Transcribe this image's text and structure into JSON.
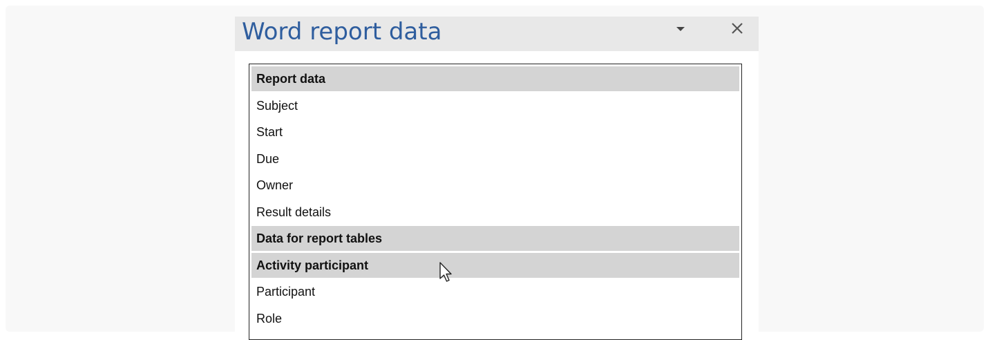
{
  "pane": {
    "title": "Word report data",
    "close_icon": "close-icon",
    "dropdown_icon": "dropdown-arrow-icon"
  },
  "list": {
    "rows": [
      {
        "label": "Report data",
        "type": "header"
      },
      {
        "label": "Subject",
        "type": "item"
      },
      {
        "label": "Start",
        "type": "item"
      },
      {
        "label": "Due",
        "type": "item"
      },
      {
        "label": "Owner",
        "type": "item"
      },
      {
        "label": "Result details",
        "type": "item"
      },
      {
        "label": "Data for report tables",
        "type": "header"
      },
      {
        "label": "Activity participant",
        "type": "header"
      },
      {
        "label": "Participant",
        "type": "item"
      },
      {
        "label": "Role",
        "type": "item"
      }
    ]
  },
  "colors": {
    "title": "#2e5d9e",
    "header_bg": "#d4d4d4",
    "pane_header_bg": "#e8e8e8"
  },
  "cursor_icon": "mouse-pointer-icon"
}
